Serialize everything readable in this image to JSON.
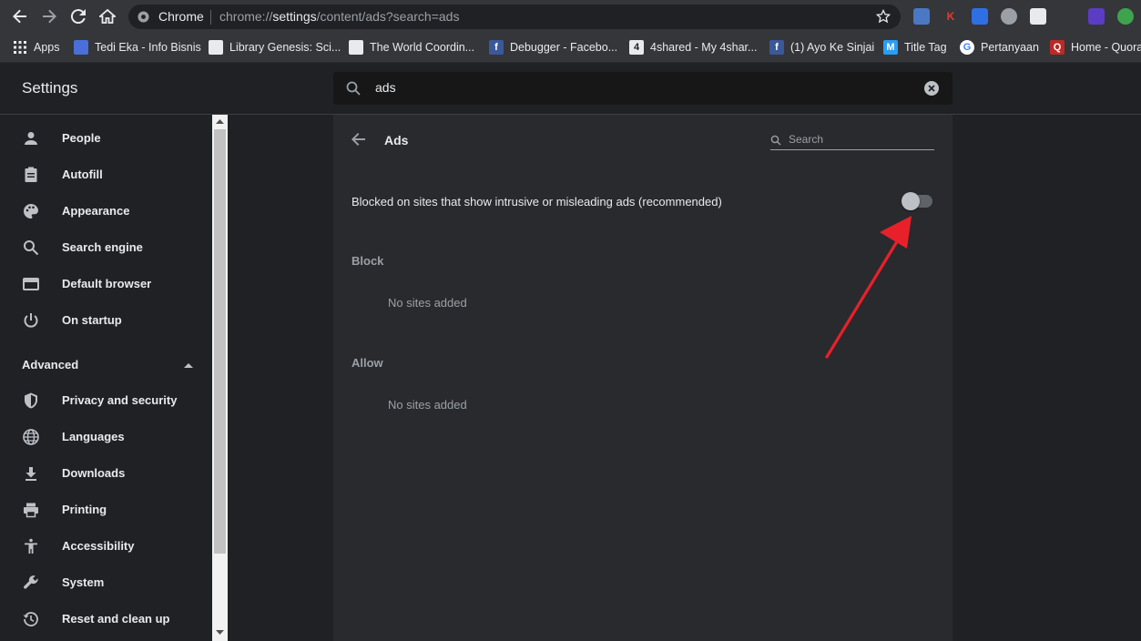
{
  "browser": {
    "omnibox": {
      "app_label": "Chrome",
      "url_prefix": "chrome://",
      "url_host": "settings",
      "url_rest": "/content/ads?search=ads"
    }
  },
  "bookmarks": [
    {
      "label": "Apps",
      "icon": "apps-grid-icon",
      "color": "#e8eaed"
    },
    {
      "label": "Tedi Eka - Info Bisnis",
      "icon": "blog-icon",
      "color": "#4a6fd8"
    },
    {
      "label": "Library Genesis: Sci...",
      "icon": "book-icon",
      "color": "#e8eaed"
    },
    {
      "label": "The World Coordin...",
      "icon": "shield-logo-icon",
      "color": "#e8eaed"
    },
    {
      "label": "Debugger - Facebo...",
      "icon": "facebook-icon",
      "color": "#3b5998"
    },
    {
      "label": "4shared - My 4shar...",
      "icon": "4shared-icon",
      "color": "#e8eaed"
    },
    {
      "label": "(1) Ayo Ke Sinjai",
      "icon": "facebook-icon",
      "color": "#3b5998"
    },
    {
      "label": "Title Tag",
      "icon": "moz-icon",
      "color": "#2a9df4"
    },
    {
      "label": "Pertanyaan",
      "icon": "google-icon",
      "color": "#ffffff"
    },
    {
      "label": "Home - Quora",
      "icon": "quora-icon",
      "color": "#b92b27"
    }
  ],
  "header": {
    "title": "Settings",
    "search_value": "ads"
  },
  "sidebar": {
    "items": [
      {
        "label": "People",
        "icon": "person-icon"
      },
      {
        "label": "Autofill",
        "icon": "clipboard-icon"
      },
      {
        "label": "Appearance",
        "icon": "palette-icon"
      },
      {
        "label": "Search engine",
        "icon": "search-icon"
      },
      {
        "label": "Default browser",
        "icon": "browser-window-icon"
      },
      {
        "label": "On startup",
        "icon": "power-icon"
      }
    ],
    "advanced_label": "Advanced",
    "advanced_items": [
      {
        "label": "Privacy and security",
        "icon": "shield-icon"
      },
      {
        "label": "Languages",
        "icon": "globe-icon"
      },
      {
        "label": "Downloads",
        "icon": "download-icon"
      },
      {
        "label": "Printing",
        "icon": "printer-icon"
      },
      {
        "label": "Accessibility",
        "icon": "accessibility-icon"
      },
      {
        "label": "System",
        "icon": "wrench-icon"
      },
      {
        "label": "Reset and clean up",
        "icon": "history-icon"
      }
    ]
  },
  "main": {
    "title": "Ads",
    "search_placeholder": "Search",
    "toggle_label": "Blocked on sites that show intrusive or misleading ads (recommended)",
    "toggle_on": false,
    "block_heading": "Block",
    "block_empty": "No sites added",
    "allow_heading": "Allow",
    "allow_empty": "No sites added"
  },
  "colors": {
    "page_bg": "#202124",
    "card_bg": "#292a2d",
    "toolbar_bg": "#35363a",
    "annotation_arrow": "#e8202a"
  }
}
